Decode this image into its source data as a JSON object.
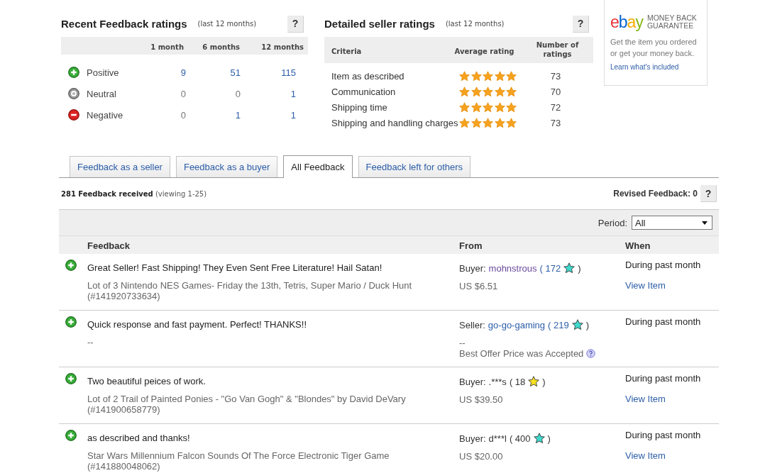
{
  "recent_ratings": {
    "title": "Recent Feedback ratings",
    "subtitle": "(last 12 months)",
    "help": "?",
    "columns": [
      "1 month",
      "6 months",
      "12 months"
    ],
    "rows": [
      {
        "kind": "positive",
        "label": "Positive",
        "counts": [
          {
            "text": "9",
            "link": true
          },
          {
            "text": "51",
            "link": true
          },
          {
            "text": "115",
            "link": true
          }
        ]
      },
      {
        "kind": "neutral",
        "label": "Neutral",
        "counts": [
          {
            "text": "0",
            "link": false
          },
          {
            "text": "0",
            "link": false
          },
          {
            "text": "1",
            "link": true
          }
        ]
      },
      {
        "kind": "negative",
        "label": "Negative",
        "counts": [
          {
            "text": "0",
            "link": false
          },
          {
            "text": "1",
            "link": true
          },
          {
            "text": "1",
            "link": true
          }
        ]
      }
    ]
  },
  "seller_ratings": {
    "title": "Detailed seller ratings",
    "subtitle": "(last 12 months)",
    "help": "?",
    "columns": [
      "Criteria",
      "Average rating",
      "Number of ratings"
    ],
    "rows": [
      {
        "criteria": "Item as described",
        "stars": 5,
        "count": "73"
      },
      {
        "criteria": "Communication",
        "stars": 5,
        "count": "70"
      },
      {
        "criteria": "Shipping time",
        "stars": 5,
        "count": "72"
      },
      {
        "criteria": "Shipping and handling charges",
        "stars": 5,
        "count": "73"
      }
    ]
  },
  "guarantee": {
    "logo": "ebay",
    "tagline": "MONEY BACK GUARANTEE",
    "text": "Get the item you ordered or get your money back.",
    "link": "Learn what's included"
  },
  "tabs": [
    {
      "label": "Feedback as a seller",
      "selected": false
    },
    {
      "label": "Feedback as a buyer",
      "selected": false
    },
    {
      "label": "All Feedback",
      "selected": true
    },
    {
      "label": "Feedback left for others",
      "selected": false
    }
  ],
  "summary": {
    "text": "**281 Feedback received** (viewing 1-25)",
    "revised": "Revised Feedback: 0",
    "help": "?"
  },
  "filter": {
    "label": "Period:",
    "value": "All"
  },
  "table": {
    "columns": [
      "Feedback",
      "From",
      "When"
    ],
    "rows": [
      {
        "kind": "positive",
        "comment": "Great Seller! Fast Shipping! They Even Sent Free Literature! Hail Satan!",
        "item": "Lot of 3 Nintendo NES Games- Friday the 13th, Tetris, Super Mario / Duck Hunt (#141920733634)",
        "from": {
          "role": "Buyer:",
          "name": "mohnstrous",
          "kind": "visited",
          "score": "( 172",
          "color": "#3fd8cc",
          "close": ")"
        },
        "price": "US $6.51",
        "when": "During past month",
        "action": "View Item"
      },
      {
        "kind": "positive",
        "comment": "Quick response and fast payment. Perfect! THANKS!!",
        "item": "--",
        "from": {
          "role": "Seller:",
          "name": "go-go-gaming",
          "kind": "link",
          "score": "( 219",
          "color": "#3fd8cc",
          "close": ")"
        },
        "price": "--",
        "note": "Best Offer Price was Accepted",
        "when": "During past month"
      },
      {
        "kind": "positive",
        "comment": "Two beautiful peices of work.",
        "item": "Lot of 2 Trail of Painted Ponies - \"Go Van Gogh\" & \"Blondes\" by David DeVary (#141900658779)",
        "from": {
          "role": "Buyer:",
          "name": ".***s",
          "kind": "plain",
          "score": "( 18",
          "color": "#f6e022",
          "close": ")"
        },
        "price": "US $39.50",
        "when": "During past month",
        "action": "View Item"
      },
      {
        "kind": "positive",
        "comment": "as described and thanks!",
        "item": "Star Wars Millennium Falcon Sounds Of The Force Electronic Tiger Game (#141880048062)",
        "from": {
          "role": "Buyer:",
          "name": "d***l",
          "kind": "plain",
          "score": "( 400",
          "color": "#3fd8cc",
          "close": ")"
        },
        "price": "US $20.00",
        "when": "During past month",
        "action": "View Item"
      }
    ]
  }
}
